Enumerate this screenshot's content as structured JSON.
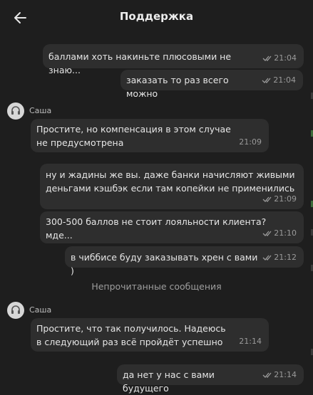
{
  "header": {
    "title": "Поддержка",
    "back_icon": "arrow-left-icon"
  },
  "contact": {
    "name": "Саша",
    "avatar_icon": "headset-icon"
  },
  "messages": [
    {
      "text": "баллами хоть накиньте плюсовыми не знаю...",
      "time": "21:04",
      "outgoing": true
    },
    {
      "text": "заказать то раз всего можно",
      "time": "21:04",
      "outgoing": true
    },
    {
      "text": "Простите, но компенсация в этом случае не предусмотрена",
      "time": "21:09",
      "outgoing": false
    },
    {
      "text": "ну и жадины же вы. даже банки начисляют живыми деньгами кэшбэк если там копейки не применились",
      "time": "21:09",
      "outgoing": true
    },
    {
      "text": "300-500 баллов не стоит лояльности клиента? мде...",
      "time": "21:10",
      "outgoing": true
    },
    {
      "text": "в чиббисе буду заказывать хрен с вами )",
      "time": "21:12",
      "outgoing": true
    },
    {
      "text": "Простите, что так получилось. Надеюсь в следующий раз всё пройдёт успешно",
      "time": "21:14",
      "outgoing": false
    },
    {
      "text": "да нет у нас с вами будущего",
      "time": "21:14",
      "outgoing": true
    }
  ],
  "unread_divider": "Непрочитанные сообщения",
  "colors": {
    "background": "#1e1e1e",
    "bubble": "#2e2e2e",
    "meta_text": "#9a9a9a",
    "accent_green": "#3d6b3a"
  }
}
